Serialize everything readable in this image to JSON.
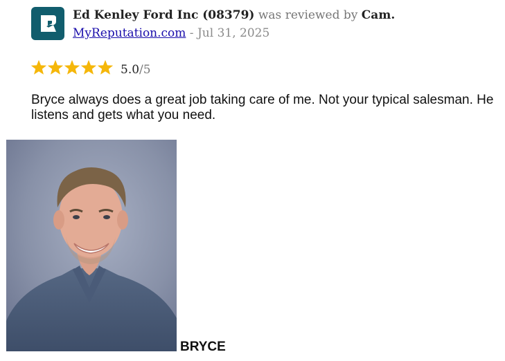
{
  "review": {
    "business": "Ed Kenley Ford Inc (08379)",
    "reviewed_by_text": "was reviewed by",
    "reviewer": "Cam.",
    "source_link": "MyReputation.com",
    "date_separator": " - ",
    "date": "Jul 31, 2025",
    "rating": {
      "stars": 5,
      "score": "5.0",
      "out_of": "/5"
    },
    "body": "Bryce always does a great job taking care of me. Not your typical salesman. He listens and gets what you need.",
    "photo_caption": "BRYCE"
  },
  "icons": {
    "logo": "reputation-logo-icon",
    "star": "star-icon"
  },
  "colors": {
    "logo_bg": "#115d6d",
    "star": "#f5b70a",
    "link": "#1a0dab"
  }
}
